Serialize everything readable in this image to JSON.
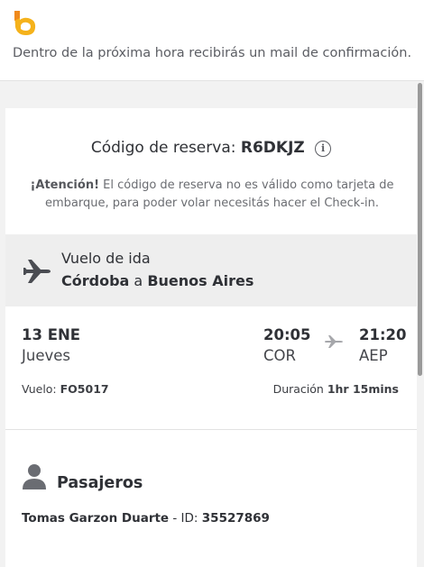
{
  "header": {
    "logo_icon": "airline-logo-icon",
    "brand_color": "#f5b21b"
  },
  "notice": {
    "text": "Dentro de la próxima hora recibirás un mail de confirmación."
  },
  "reservation": {
    "code_label": "Código de reserva:",
    "code": "R6DKJZ",
    "info_icon": "i",
    "attention_label": "¡Atención!",
    "attention_text": "El código de reserva no es válido como tarjeta de embarque, para poder volar necesitás hacer el Check-in."
  },
  "flight": {
    "section_label": "Vuelo de ida",
    "origin": "Córdoba",
    "connector": "a",
    "destination": "Buenos Aires",
    "date": "13 ENE",
    "weekday": "Jueves",
    "departure_time": "20:05",
    "departure_code": "COR",
    "arrival_time": "21:20",
    "arrival_code": "AEP",
    "flight_label": "Vuelo:",
    "flight_number": "FO5017",
    "duration_label": "Duración",
    "duration_value": "1hr 15mins"
  },
  "passengers": {
    "title": "Pasajeros",
    "name": "Tomas Garzon Duarte",
    "id_label": "- ID:",
    "id_value": "35527869"
  }
}
